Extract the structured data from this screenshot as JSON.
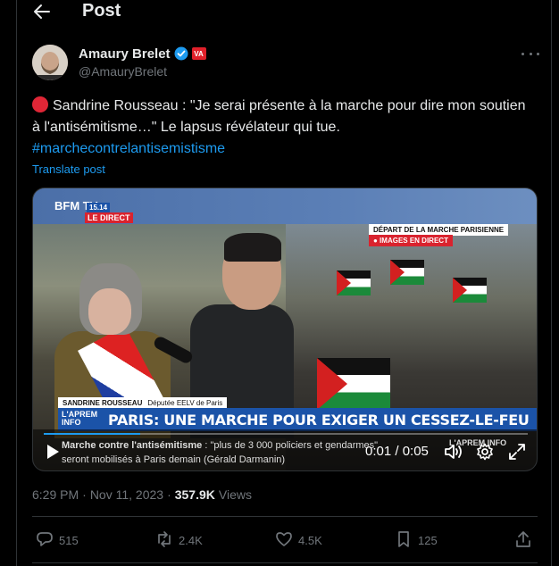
{
  "header": {
    "title": "Post"
  },
  "author": {
    "name": "Amaury Brelet",
    "handle": "@AmauryBrelet",
    "affiliation_badge": "VA",
    "verified": true
  },
  "post": {
    "text_line": "Sandrine Rousseau : \"Je serai présente à la marche pour dire mon soutien à l'antisémitisme…\" Le lapsus révélateur qui tue.",
    "hashtag": "#marchecontrelantisemistisme",
    "translate_label": "Translate post"
  },
  "video": {
    "channel": "BFM TV.",
    "channel_time": "15.14",
    "live_label": "LE DIRECT",
    "right_caption": "DÉPART DE LA MARCHE PARISIENNE",
    "right_live": "● IMAGES EN DIRECT",
    "speaker_name": "SANDRINE ROUSSEAU",
    "speaker_role": "Députée EELV de Paris",
    "show_tag": "L'APREM INFO",
    "headline": "PARIS: UNE MARCHE POUR EXIGER UN CESSEZ-LE-FEU",
    "ticker_bold": "Marche contre l'antisémitisme",
    "ticker_rest": " : \"plus de 3 000 policiers et gendarmes\" seront mobilisés à Paris demain (Gérald Darmanin)",
    "ticker_brand": "L'APREM INFO",
    "time_display": "0:01 / 0:05",
    "progress": 0.2
  },
  "meta": {
    "time": "6:29 PM",
    "separator": "·",
    "date": "Nov 11, 2023",
    "views_count": "357.9K",
    "views_label": "Views"
  },
  "actions": {
    "replies": "515",
    "reposts": "2.4K",
    "likes": "4.5K",
    "bookmarks": "125"
  },
  "colors": {
    "background": "#000000",
    "text": "#e7e9ea",
    "muted": "#71767b",
    "accent": "#1d9bf0",
    "border": "#2f3336"
  },
  "icons": [
    "back-arrow-icon",
    "verified-badge-icon",
    "more-icon",
    "red-circle-emoji",
    "play-icon",
    "volume-icon",
    "settings-icon",
    "fullscreen-icon",
    "reply-icon",
    "repost-icon",
    "like-icon",
    "bookmark-icon",
    "share-icon"
  ]
}
